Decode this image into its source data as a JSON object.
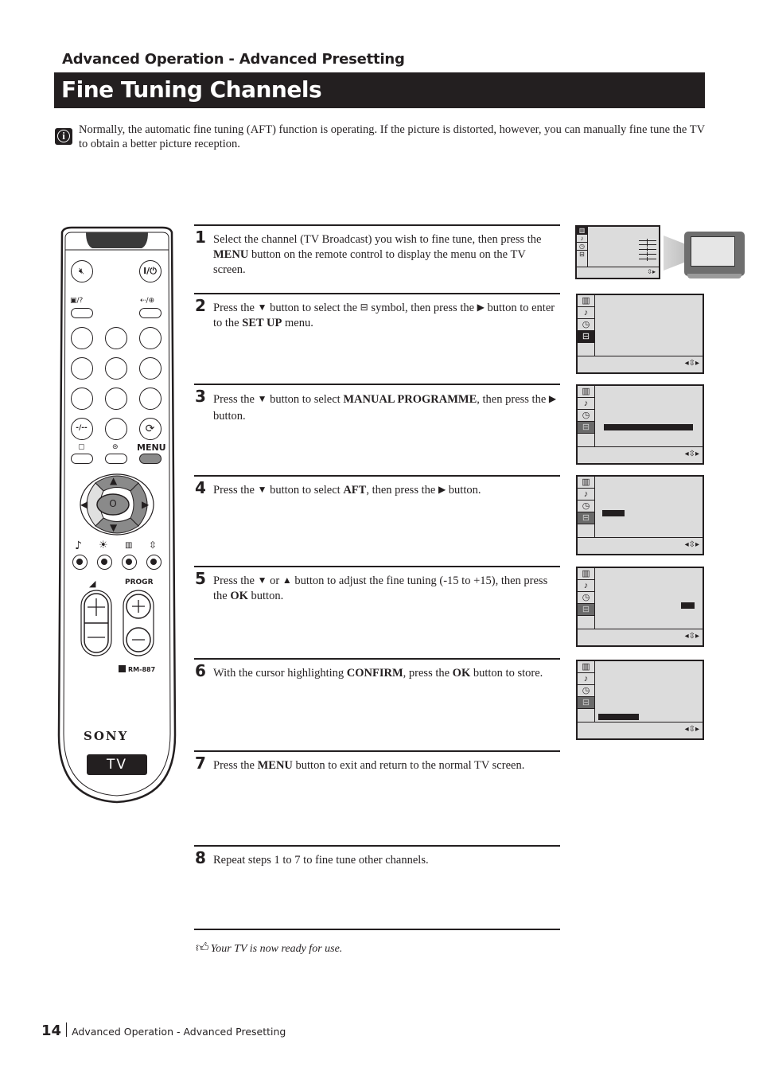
{
  "header": {
    "section": "Advanced Operation - Advanced Presetting",
    "title": "Fine Tuning Channels"
  },
  "intro": {
    "icon": "info-icon",
    "text": "Normally, the automatic fine tuning (AFT) function is operating. If the picture is distorted, however, you can manually fine tune the TV to obtain a better picture reception."
  },
  "steps": [
    {
      "number": "1",
      "parts": [
        "Select the channel (TV Broadcast) you wish to fine tune, then press the ",
        "MENU",
        " button on the remote control to display the menu on the TV screen."
      ]
    },
    {
      "number": "2",
      "parts": [
        "Press the ",
        "↓",
        " button to select the ",
        "set-up-icon",
        " symbol, then press the ",
        "→",
        " button to enter to the ",
        "SET UP",
        " menu."
      ]
    },
    {
      "number": "3",
      "parts": [
        "Press the ",
        "↓",
        " button to select ",
        "MANUAL PROGRAMME",
        ", then press the ",
        "→",
        " button."
      ]
    },
    {
      "number": "4",
      "parts": [
        "Press the ",
        "↓",
        " button to select ",
        "AFT",
        ", then press the ",
        "→",
        " button."
      ]
    },
    {
      "number": "5",
      "parts": [
        "Press the ",
        "↓",
        " or ",
        "↑",
        " button to adjust the fine tuning (-15 to +15), then press the ",
        "OK",
        " button."
      ]
    },
    {
      "number": "6",
      "parts": [
        "With the cursor highlighting ",
        "CONFIRM",
        ", press the ",
        "OK",
        " button to store."
      ]
    },
    {
      "number": "7",
      "parts": [
        "Press the ",
        "MENU",
        " button to exit and return to the normal TV screen."
      ]
    },
    {
      "number": "8",
      "parts": [
        "Repeat steps 1 to 7 to fine tune other channels."
      ]
    }
  ],
  "tip": {
    "icon": "thumbs-up-icon",
    "text": "Your TV is now ready for use."
  },
  "footer": {
    "page_number": "14",
    "section": "Advanced Operation - Advanced Presetting"
  },
  "remote": {
    "menu_label": "MENU",
    "progr_label": "PROGR",
    "model": "RM-887",
    "brand": "SONY",
    "badge": "TV",
    "ok_label": "O",
    "slash_label": "-/--"
  },
  "screens": {
    "menu_icons": [
      "picture-icon",
      "sound-icon",
      "timer-icon",
      "setup-icon"
    ],
    "glyphs": {
      "picture": "▥",
      "sound": "♪",
      "timer": "◷",
      "setup": "⊟",
      "nav": "◂⇳▸"
    }
  }
}
